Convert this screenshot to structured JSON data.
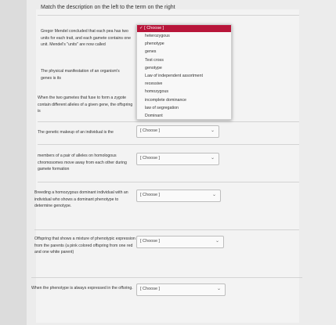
{
  "instruction": "Match the description on the left to the term on the right",
  "questions": [
    {
      "text": "Gregor Mendel concluded that each pea has two units for each trait, and each gamete contains one unit. Mendel's \"units\" are now called",
      "select": "✓ [ Choose ]"
    },
    {
      "text": "The physical manifestation of an organism's genes is its",
      "select": "[ Choose ]"
    },
    {
      "text": "When the two gametes that fuse to form a zygote contain different alleles of a given gene, the offspring is",
      "select": "[ Choose ]"
    },
    {
      "text": "The genetic makeup of an individual is the",
      "select": "[ Choose ]"
    },
    {
      "text": "members of a pair of alleles on homologous chromosomes move away from each other during gamete formation",
      "select": "[ Choose ]"
    },
    {
      "text": "Breeding a homozygous dominant individual with an individual who shows a dominant phenotype to determine genotype.",
      "select": "[ Choose ]"
    },
    {
      "text": "Offspring that shows a mixture of phenotypic expression from the parents (a pink colored offspring from one red and one white parent)",
      "select": "[ Choose ]"
    },
    {
      "text": "When the phenotype is always expressed in the offsring.",
      "select": "[ Choose ]"
    }
  ],
  "dropdown": {
    "header": "✓ [ Choose ]",
    "options": [
      "heterozygous",
      "phenotype",
      "genes",
      "Test cross",
      "genotype",
      "Law of independent assortment",
      "recessive",
      "homozygous",
      "incomplete dominance",
      "law of segregation",
      "Dominant"
    ]
  },
  "icons": {
    "chevron": "chevron-down-icon"
  },
  "colors": {
    "dropdown_header": "#b8163a"
  }
}
